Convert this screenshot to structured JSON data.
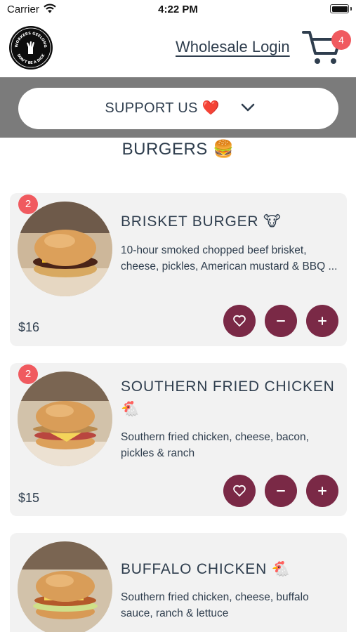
{
  "status_bar": {
    "carrier": "Carrier",
    "time": "4:22 PM"
  },
  "header": {
    "logo_text_top": "WORKERS GEELONG",
    "logo_text_bottom": "DON'T BE A DICK",
    "wholesale_label": "Wholesale Login",
    "cart_count": "4"
  },
  "support": {
    "label": "SUPPORT US ❤️"
  },
  "section_title": "BURGERS 🍔",
  "items": [
    {
      "qty": "2",
      "name": "BRISKET BURGER 🐮",
      "description": "10-hour smoked chopped beef brisket, cheese, pickles, American mustard & BBQ ...",
      "price": "$16"
    },
    {
      "qty": "2",
      "name": "SOUTHERN FRIED CHICKEN 🐔",
      "description": "Southern fried chicken, cheese, bacon, pickles & ranch",
      "price": "$15"
    },
    {
      "name": "BUFFALO CHICKEN 🐔",
      "description": "Southern fried chicken, cheese, buffalo sauce, ranch & lettuce"
    }
  ],
  "colors": {
    "accent": "#7a2946",
    "badge": "#f05a5f",
    "text": "#2f3e4e",
    "band": "#7b7b7b"
  },
  "icons": [
    "wifi-icon",
    "battery-icon",
    "cart-icon",
    "chevron-down-icon",
    "heart-icon",
    "minus-icon",
    "plus-icon"
  ]
}
